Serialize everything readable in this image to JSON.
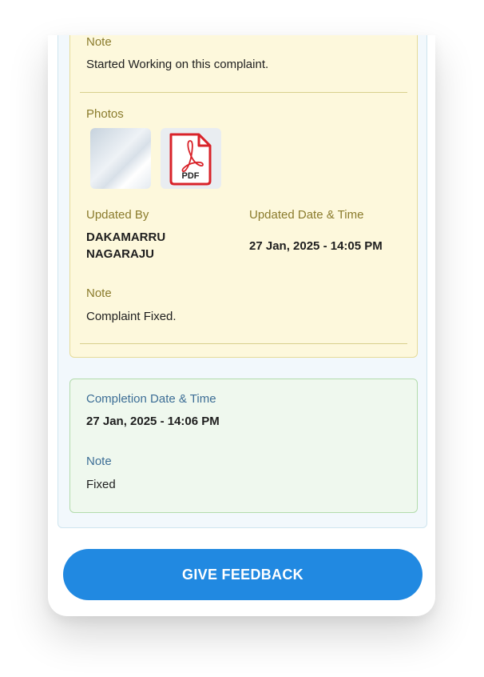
{
  "entry_started": {
    "note_label": "Note",
    "note_value": "Started Working on this complaint."
  },
  "entry_fixed": {
    "photos_label": "Photos",
    "photos": [
      {
        "icon": "image-thumbnail"
      },
      {
        "icon": "pdf-file-icon",
        "label": "PDF"
      }
    ],
    "updated_by_label": "Updated By",
    "updated_by_line1": "DAKAMARRU",
    "updated_by_line2": "NAGARAJU",
    "updated_datetime_label": "Updated Date & Time",
    "updated_datetime_value": "27 Jan, 2025 - 14:05 PM",
    "note_label": "Note",
    "note_value": "Complaint Fixed."
  },
  "completion": {
    "datetime_label": "Completion Date & Time",
    "datetime_value": "27 Jan, 2025 - 14:06 PM",
    "note_label": "Note",
    "note_value": "Fixed"
  },
  "feedback_button": {
    "label": "GIVE FEEDBACK"
  },
  "colors": {
    "button_blue": "#2189e1",
    "yellow_card_bg": "#fdf8dc",
    "yellow_label": "#8a7b2c",
    "green_card_bg": "#eff8ee",
    "green_label": "#3d6e96",
    "pdf_red": "#d9232a"
  }
}
